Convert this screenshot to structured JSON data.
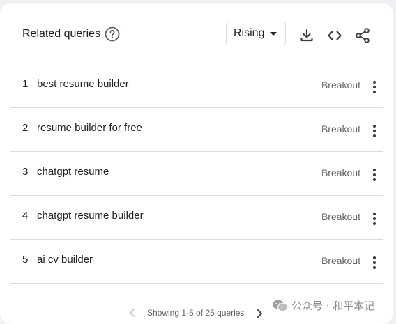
{
  "header": {
    "title": "Related queries",
    "filter_selected": "Rising"
  },
  "icons": {
    "help": "help-circle-icon",
    "download": "download-icon",
    "embed": "code-embed-icon",
    "share": "share-icon",
    "more": "more-vert-icon"
  },
  "rows": [
    {
      "rank": "1",
      "query": "best resume builder",
      "value": "Breakout"
    },
    {
      "rank": "2",
      "query": "resume builder for free",
      "value": "Breakout"
    },
    {
      "rank": "3",
      "query": "chatgpt resume",
      "value": "Breakout"
    },
    {
      "rank": "4",
      "query": "chatgpt resume builder",
      "value": "Breakout"
    },
    {
      "rank": "5",
      "query": "ai cv builder",
      "value": "Breakout"
    }
  ],
  "footer": {
    "page_info": "Showing 1-5 of 25 queries"
  },
  "watermark": {
    "text": "公众号 · 和平本记"
  },
  "colors": {
    "text": "#202124",
    "muted": "#5f6368",
    "divider": "#dadce0",
    "background": "#eef0f3"
  }
}
